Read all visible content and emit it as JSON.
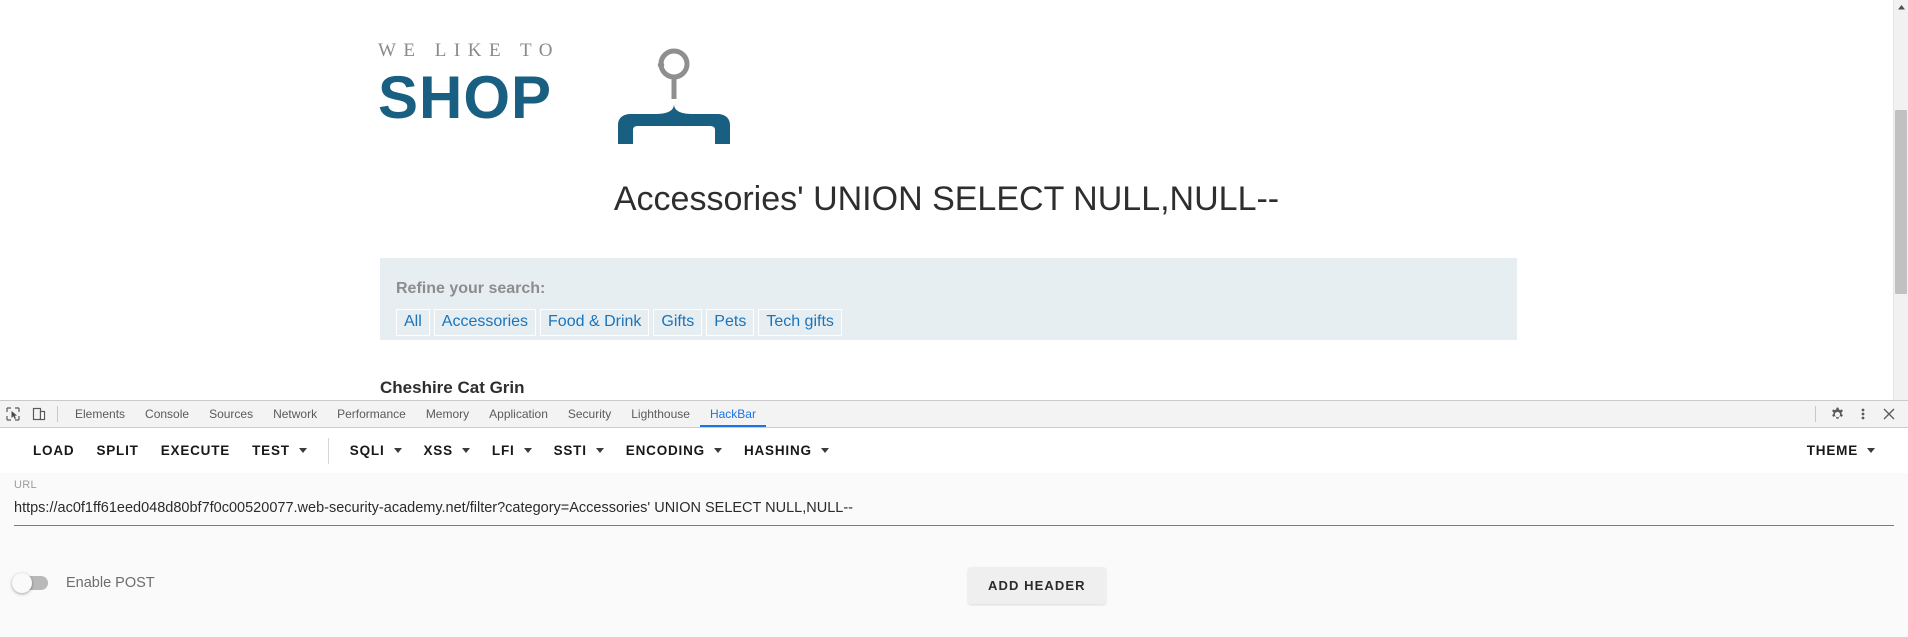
{
  "page": {
    "logo": {
      "tagline": "WE LIKE TO",
      "word": "SHOP",
      "hanger_icon": "clothes-hanger-icon",
      "tagline_color": "#8a8a8a",
      "word_color": "#195f81"
    },
    "heading": "Accessories' UNION SELECT NULL,NULL--",
    "filter": {
      "label": "Refine your search:",
      "panel_color": "#e7eef2",
      "link_color": "#1a74bb",
      "links": [
        {
          "label": "All"
        },
        {
          "label": "Accessories"
        },
        {
          "label": "Food & Drink"
        },
        {
          "label": "Gifts"
        },
        {
          "label": "Pets"
        },
        {
          "label": "Tech gifts"
        }
      ]
    },
    "products": [
      {
        "name": "Cheshire Cat Grin"
      }
    ]
  },
  "devtools": {
    "left_icons": [
      {
        "name": "inspect-element-icon"
      },
      {
        "name": "device-toolbar-icon"
      }
    ],
    "tabs": [
      {
        "label": "Elements",
        "active": false
      },
      {
        "label": "Console",
        "active": false
      },
      {
        "label": "Sources",
        "active": false
      },
      {
        "label": "Network",
        "active": false
      },
      {
        "label": "Performance",
        "active": false
      },
      {
        "label": "Memory",
        "active": false
      },
      {
        "label": "Application",
        "active": false
      },
      {
        "label": "Security",
        "active": false
      },
      {
        "label": "Lighthouse",
        "active": false
      },
      {
        "label": "HackBar",
        "active": true
      }
    ],
    "active_tab": "HackBar",
    "active_tab_color": "#1a73e8",
    "right_icons": [
      {
        "name": "settings-gear-icon"
      },
      {
        "name": "more-options-icon"
      },
      {
        "name": "close-devtools-icon"
      }
    ]
  },
  "hackbar": {
    "buttons": [
      {
        "label": "LOAD",
        "caret": false
      },
      {
        "label": "SPLIT",
        "caret": false
      },
      {
        "label": "EXECUTE",
        "caret": false
      },
      {
        "label": "TEST",
        "caret": true
      },
      {
        "label": "SQLI",
        "caret": true
      },
      {
        "label": "XSS",
        "caret": true
      },
      {
        "label": "LFI",
        "caret": true
      },
      {
        "label": "SSTI",
        "caret": true
      },
      {
        "label": "ENCODING",
        "caret": true
      },
      {
        "label": "HASHING",
        "caret": true
      }
    ],
    "theme": {
      "label": "THEME",
      "caret": true
    },
    "url": {
      "label": "URL",
      "value": "https://ac0f1ff61eed048d80bf7f0c00520077.web-security-academy.net/filter?category=Accessories' UNION SELECT NULL,NULL--"
    },
    "post": {
      "label": "Enable POST",
      "enabled": false
    },
    "add_header_label": "ADD HEADER"
  }
}
